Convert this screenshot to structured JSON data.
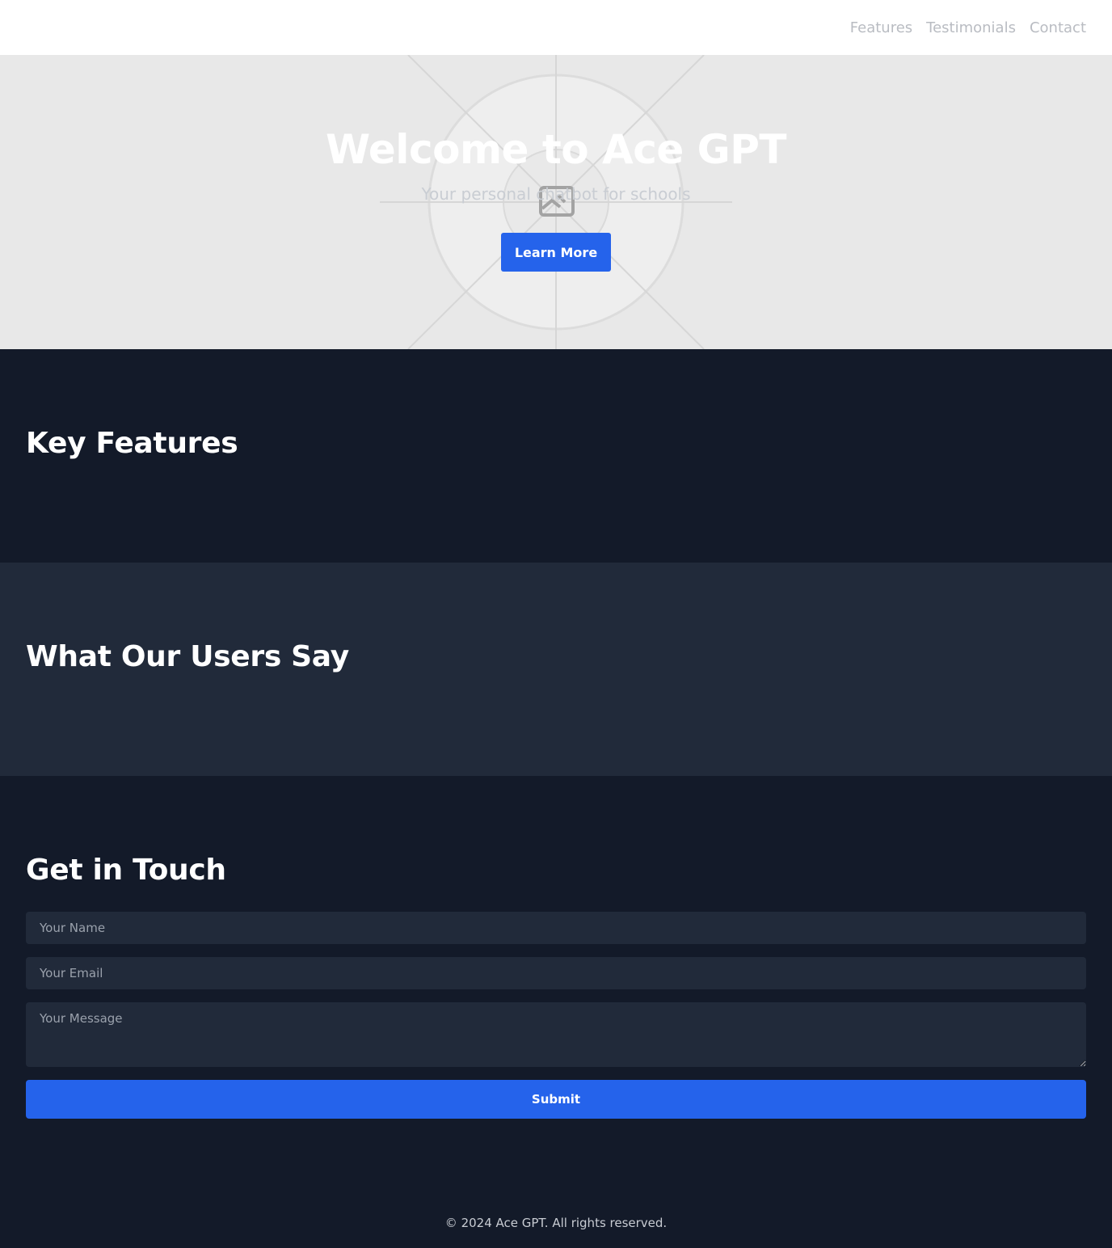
{
  "nav": {
    "items": [
      {
        "label": "Features"
      },
      {
        "label": "Testimonials"
      },
      {
        "label": "Contact"
      }
    ]
  },
  "hero": {
    "title": "Welcome to Ace GPT",
    "subtitle": "Your personal chatbot for schools",
    "button_label": "Learn More",
    "background_icon": "broken-image-icon"
  },
  "features": {
    "title": "Key Features"
  },
  "testimonials": {
    "title": "What Our Users Say"
  },
  "contact": {
    "title": "Get in Touch",
    "name_placeholder": "Your Name",
    "email_placeholder": "Your Email",
    "message_placeholder": "Your Message",
    "submit_label": "Submit"
  },
  "footer": {
    "text": "© 2024 Ace GPT. All rights reserved."
  },
  "colors": {
    "accent": "#2563eb",
    "dark_bg": "#131a29",
    "panel_bg": "#212a3a",
    "hero_bg": "#e8e8e8"
  }
}
